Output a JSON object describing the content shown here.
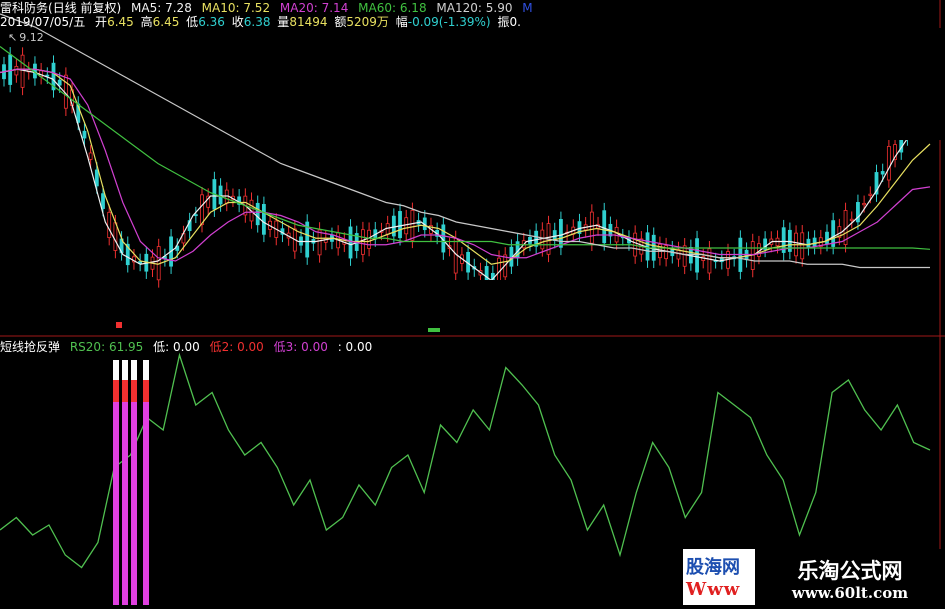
{
  "header": {
    "stock_name": "雷科防务",
    "period": "(日线 前复权)",
    "ma5_label": "MA5:",
    "ma5_value": "7.28",
    "ma10_label": "MA10:",
    "ma10_value": "7.52",
    "ma20_label": "MA20:",
    "ma20_value": "7.14",
    "ma60_label": "MA60:",
    "ma60_value": "6.18",
    "ma120_label": "MA120:",
    "ma120_value": "5.90",
    "cut_label": "M",
    "date": "2019/07/05/五",
    "open_label": "开",
    "open_value": "6.45",
    "high_label": "高",
    "high_value": "6.45",
    "low_label": "低",
    "low_value": "6.36",
    "close_label": "收",
    "close_value": "6.38",
    "vol_label": "量",
    "vol_value": "81494",
    "amt_label": "额",
    "amt_value": "5209万",
    "chg_label": "幅",
    "chg_value": "-0.09(-1.39%)",
    "amp_label": "振",
    "amp_value": "0.",
    "axis_marker": "9.12"
  },
  "indicator": {
    "name": "短线抢反弹",
    "rs_label": "RS20:",
    "rs_value": "61.95",
    "low_label": "低:",
    "low_value": "0.00",
    "low2_label": "低2:",
    "low2_value": "0.00",
    "low3_label": "低3:",
    "low3_value": "0.00",
    "extra_value": ": 0.00"
  },
  "watermark": {
    "site1_top": "股海网",
    "site1_bottom": "Www",
    "site2_name": "乐淘公式网",
    "site2_url": "www.60lt.com"
  },
  "colors": {
    "ma5": "#f0f0f0",
    "ma10": "#e8e060",
    "ma20": "#d040d0",
    "ma60": "#40c040",
    "ma120": "#c8c8c8",
    "ma_blue": "#3050e0",
    "rs_line": "#50c050",
    "up": "#f03030",
    "down": "#30d0d0",
    "signal": "#e040e0",
    "divider": "#a01818"
  },
  "chart_data": [
    {
      "type": "candlestick",
      "title": "雷科防务 (日线 前复权)",
      "series": [
        {
          "name": "MA5",
          "values": [
            8.9,
            8.95,
            8.9,
            8.8,
            8.5,
            7.6,
            6.6,
            6.1,
            5.95,
            6.0,
            6.2,
            6.7,
            7.0,
            7.0,
            6.85,
            6.6,
            6.45,
            6.3,
            6.3,
            6.35,
            6.25,
            6.35,
            6.5,
            6.55,
            6.6,
            6.4,
            6.1,
            5.9,
            5.7,
            6.0,
            6.3,
            6.35,
            6.4,
            6.5,
            6.55,
            6.45,
            6.3,
            6.2,
            6.15,
            6.1,
            6.05,
            6.0,
            6.05,
            6.1,
            6.3,
            6.3,
            6.25,
            6.3,
            6.45,
            6.7,
            7.1,
            7.6,
            8.0,
            8.2
          ]
        },
        {
          "name": "MA10",
          "values": [
            8.9,
            8.95,
            8.95,
            8.9,
            8.7,
            8.0,
            7.0,
            6.3,
            6.0,
            5.95,
            6.05,
            6.4,
            6.75,
            6.9,
            6.9,
            6.75,
            6.6,
            6.45,
            6.35,
            6.35,
            6.3,
            6.3,
            6.4,
            6.5,
            6.55,
            6.5,
            6.35,
            6.15,
            5.95,
            6.0,
            6.2,
            6.3,
            6.35,
            6.45,
            6.5,
            6.45,
            6.35,
            6.25,
            6.2,
            6.15,
            6.1,
            6.05,
            6.05,
            6.1,
            6.2,
            6.25,
            6.25,
            6.3,
            6.4,
            6.55,
            6.85,
            7.2,
            7.55,
            7.8
          ]
        },
        {
          "name": "MA20",
          "values": [
            8.9,
            8.95,
            8.95,
            8.9,
            8.8,
            8.4,
            7.7,
            6.9,
            6.3,
            6.05,
            6.0,
            6.15,
            6.4,
            6.6,
            6.75,
            6.75,
            6.7,
            6.6,
            6.45,
            6.4,
            6.3,
            6.25,
            6.25,
            6.3,
            6.4,
            6.4,
            6.35,
            6.25,
            6.1,
            6.05,
            6.05,
            6.15,
            6.25,
            6.35,
            6.4,
            6.4,
            6.35,
            6.3,
            6.25,
            6.2,
            6.15,
            6.1,
            6.1,
            6.1,
            6.15,
            6.2,
            6.2,
            6.25,
            6.3,
            6.45,
            6.6,
            6.85,
            7.1,
            7.14
          ]
        },
        {
          "name": "MA60",
          "values": [
            9.3,
            9.1,
            8.9,
            8.7,
            8.5,
            8.3,
            8.1,
            7.9,
            7.7,
            7.5,
            7.35,
            7.2,
            7.05,
            6.95,
            6.85,
            6.75,
            6.65,
            6.55,
            6.5,
            6.45,
            6.4,
            6.35,
            6.35,
            6.3,
            6.3,
            6.3,
            6.3,
            6.3,
            6.3,
            6.25,
            6.25,
            6.25,
            6.25,
            6.25,
            6.25,
            6.25,
            6.25,
            6.2,
            6.2,
            6.2,
            6.2,
            6.2,
            6.2,
            6.2,
            6.2,
            6.2,
            6.2,
            6.2,
            6.2,
            6.2,
            6.2,
            6.2,
            6.2,
            6.18
          ]
        },
        {
          "name": "MA120",
          "values": [
            9.8,
            9.7,
            9.6,
            9.45,
            9.3,
            9.15,
            9.0,
            8.85,
            8.7,
            8.55,
            8.4,
            8.25,
            8.1,
            7.95,
            7.8,
            7.65,
            7.5,
            7.4,
            7.3,
            7.2,
            7.1,
            7.0,
            6.9,
            6.85,
            6.75,
            6.7,
            6.6,
            6.55,
            6.5,
            6.45,
            6.4,
            6.35,
            6.3,
            6.3,
            6.25,
            6.2,
            6.2,
            6.15,
            6.15,
            6.1,
            6.1,
            6.05,
            6.05,
            6.0,
            6.0,
            6.0,
            5.95,
            5.95,
            5.95,
            5.9,
            5.9,
            5.9,
            5.9,
            5.9
          ]
        }
      ]
    },
    {
      "type": "line",
      "title": "短线抢反弹",
      "series": [
        {
          "name": "RS20",
          "values": [
            30,
            35,
            28,
            32,
            20,
            15,
            25,
            55,
            60,
            75,
            70,
            100,
            80,
            85,
            70,
            60,
            65,
            55,
            40,
            50,
            30,
            35,
            48,
            40,
            55,
            60,
            45,
            72,
            65,
            78,
            70,
            95,
            88,
            80,
            60,
            50,
            30,
            40,
            20,
            45,
            65,
            55,
            35,
            45,
            85,
            80,
            75,
            60,
            50,
            28,
            45,
            85,
            90,
            78,
            70,
            80,
            65,
            62
          ]
        }
      ],
      "ylim": [
        0,
        100
      ]
    }
  ]
}
